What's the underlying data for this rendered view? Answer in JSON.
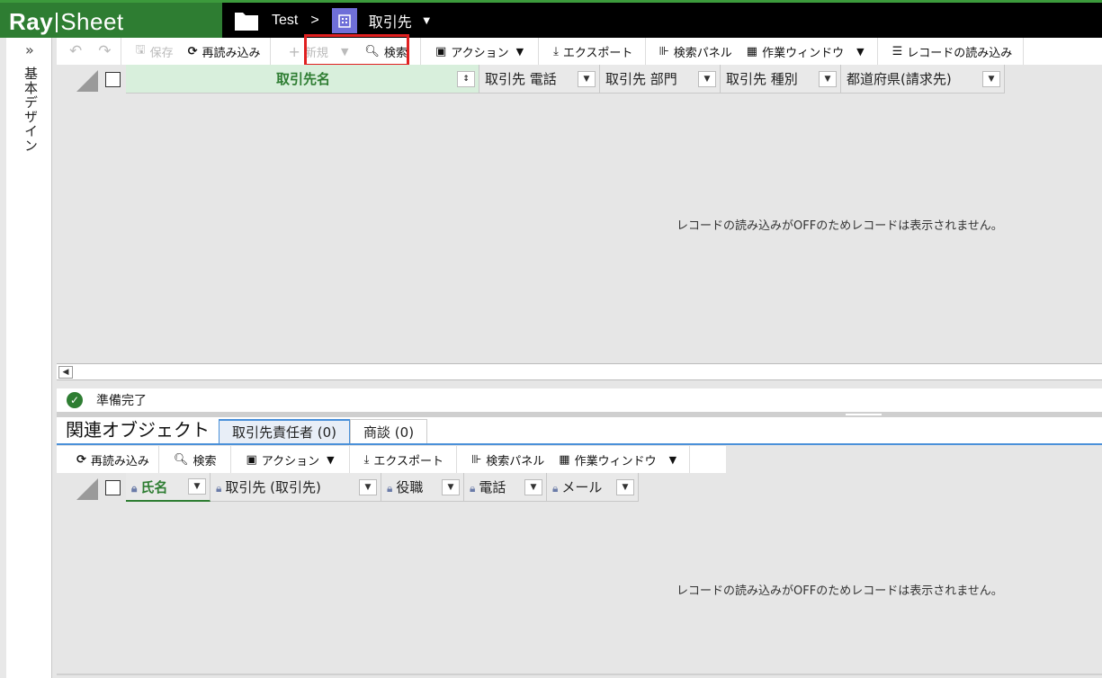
{
  "app": {
    "logo_bold": "Ray",
    "logo_light": "Sheet",
    "breadcrumb": {
      "folder": "Test",
      "separator": ">",
      "object": "取引先"
    }
  },
  "rail": {
    "expand": "»",
    "label": "基本デザイン"
  },
  "main_toolbar": {
    "undo": "↶",
    "redo": "↷",
    "save": "保存",
    "reload": "再読み込み",
    "new": "新規",
    "search": "検索",
    "action": "アクション",
    "export": "エクスポート",
    "search_panel": "検索パネル",
    "work_window": "作業ウィンドウ",
    "record_load": "レコードの読み込み"
  },
  "main_grid": {
    "columns": [
      "取引先名",
      "取引先 電話",
      "取引先 部門",
      "取引先 種別",
      "都道府県(請求先)"
    ],
    "empty_message": "レコードの読み込みがOFFのためレコードは表示されません。"
  },
  "status": {
    "text": "準備完了"
  },
  "related": {
    "title": "関連オブジェクト",
    "tabs": [
      "取引先責任者 (0)",
      "商談 (0)"
    ]
  },
  "related_toolbar": {
    "reload": "再読み込み",
    "search": "検索",
    "action": "アクション",
    "export": "エクスポート",
    "search_panel": "検索パネル",
    "work_window": "作業ウィンドウ"
  },
  "related_grid": {
    "columns": [
      "氏名",
      "取引先 (取引先)",
      "役職",
      "電話",
      "メール"
    ],
    "empty_message": "レコードの読み込みがOFFのためレコードは表示されません。"
  },
  "colors": {
    "brand_green": "#2e7d32",
    "highlight_red": "#e02020",
    "tab_blue": "#4a90d9",
    "object_icon": "#6f6fd8"
  }
}
